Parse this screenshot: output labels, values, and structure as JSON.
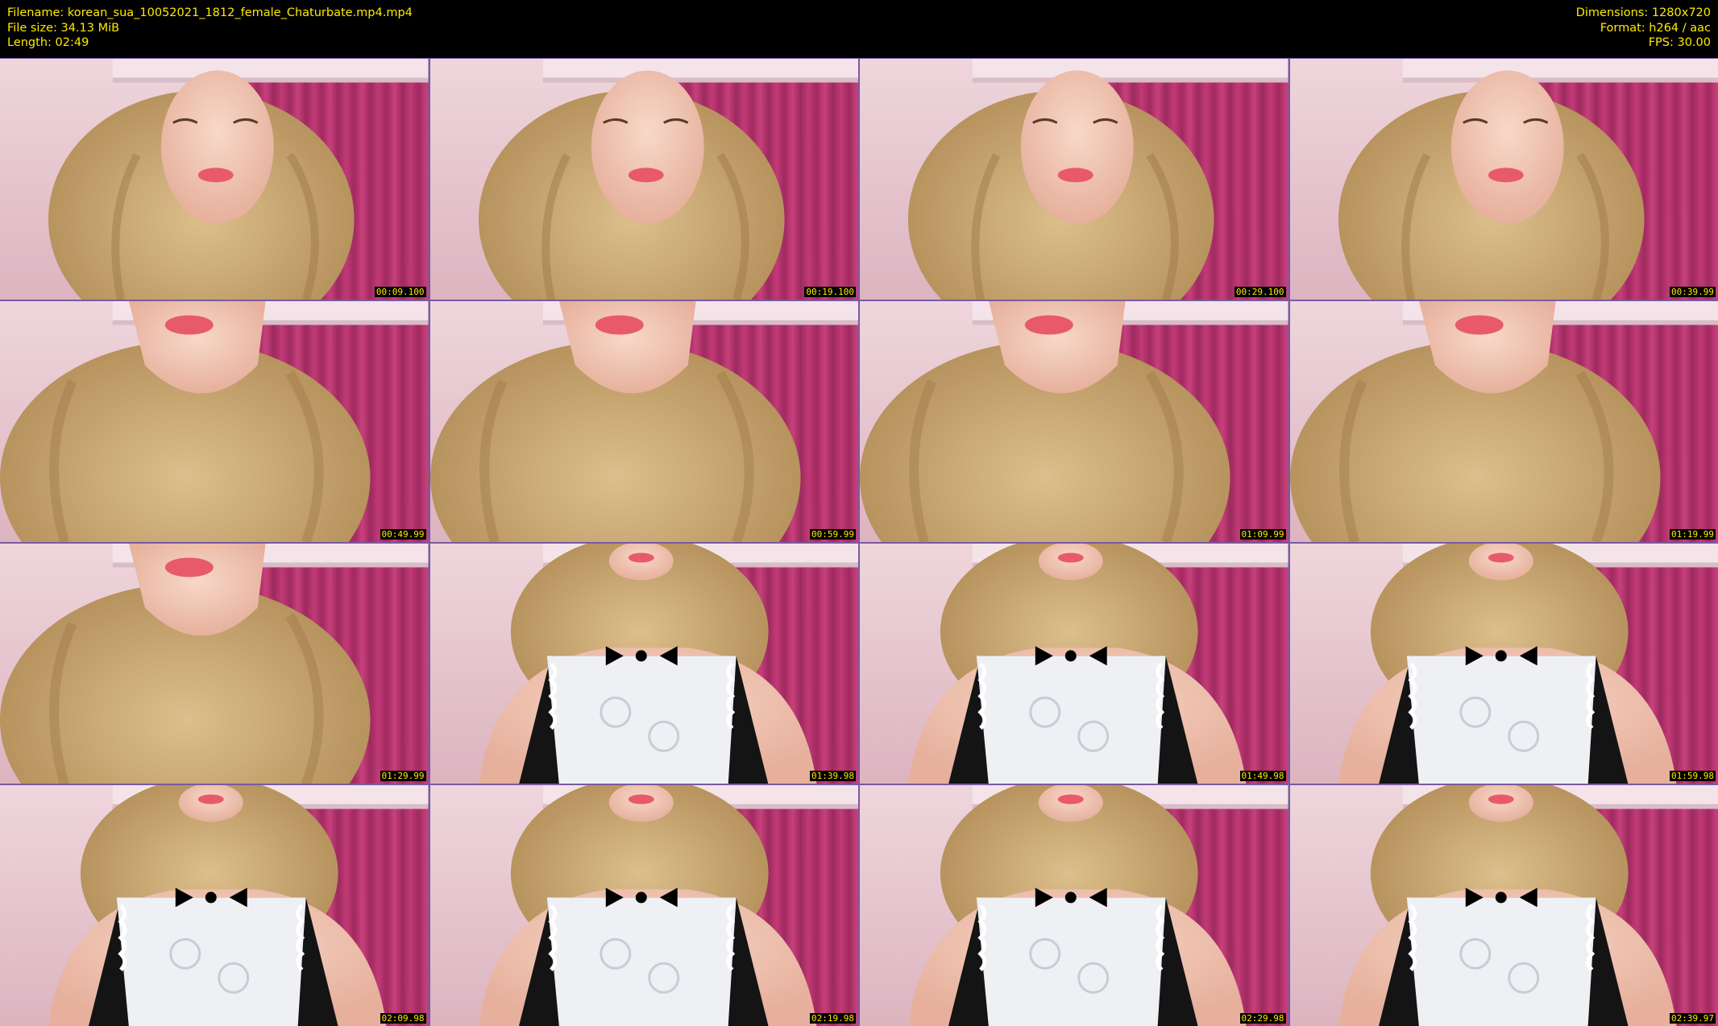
{
  "header": {
    "filename": "Filename: korean_sua_10052021_1812_female_Chaturbate.mp4.mp4",
    "filesize": "File size: 34.13 MiB",
    "length": "Length: 02:49",
    "dimensions": "Dimensions: 1280x720",
    "format": "Format: h264 / aac",
    "fps": "FPS: 30.00"
  },
  "colors": {
    "text": "#ffea00",
    "background": "#000000",
    "border": "#7a5aa0",
    "wall": "#e8c8d0",
    "curtain": "#b0306a",
    "hair": "#c9a56e",
    "skin": "#f0c4b4",
    "lips": "#e85a6a"
  },
  "thumbnails": [
    {
      "time": "00:09.100",
      "scene": "face"
    },
    {
      "time": "00:19.100",
      "scene": "face"
    },
    {
      "time": "00:29.100",
      "scene": "face"
    },
    {
      "time": "00:39.99",
      "scene": "face"
    },
    {
      "time": "00:49.99",
      "scene": "chin"
    },
    {
      "time": "00:59.99",
      "scene": "chin"
    },
    {
      "time": "01:09.99",
      "scene": "chin"
    },
    {
      "time": "01:19.99",
      "scene": "chin"
    },
    {
      "time": "01:29.99",
      "scene": "chin"
    },
    {
      "time": "01:39.98",
      "scene": "body"
    },
    {
      "time": "01:49.98",
      "scene": "body"
    },
    {
      "time": "01:59.98",
      "scene": "body"
    },
    {
      "time": "02:09.98",
      "scene": "body"
    },
    {
      "time": "02:19.98",
      "scene": "body"
    },
    {
      "time": "02:29.98",
      "scene": "body"
    },
    {
      "time": "02:39.97",
      "scene": "body"
    }
  ]
}
